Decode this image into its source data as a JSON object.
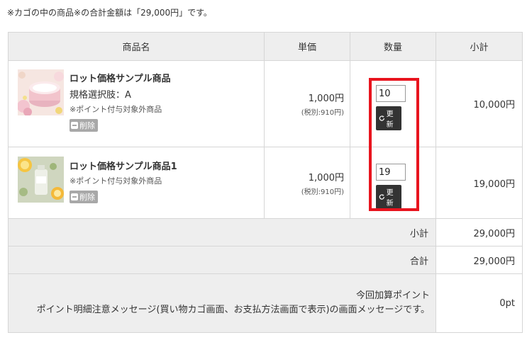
{
  "notice": "※カゴの中の商品※の合計金額は「29,000円」です。",
  "columns": {
    "product": "商品名",
    "unit_price": "単価",
    "quantity": "数量",
    "subtotal": "小計"
  },
  "items": [
    {
      "name": "ロット価格サンプル商品",
      "spec": "規格選択肢：A",
      "note": "※ポイント付与対象外商品",
      "delete_label": "削除",
      "price": "1,000円",
      "tax_note": "(税別:910円)",
      "quantity": "10",
      "update_label": "更新",
      "subtotal": "10,000円"
    },
    {
      "name": "ロット価格サンプル商品1",
      "spec": "",
      "note": "※ポイント付与対象外商品",
      "delete_label": "削除",
      "price": "1,000円",
      "tax_note": "(税別:910円)",
      "quantity": "19",
      "update_label": "更新",
      "subtotal": "19,000円"
    }
  ],
  "summary": {
    "subtotal_label": "小計",
    "subtotal_value": "29,000円",
    "total_label": "合計",
    "total_value": "29,000円",
    "points_label": "今回加算ポイント",
    "points_message": "ポイント明細注意メッセージ(買い物カゴ画面、お支払方法画面で表示)の画面メッセージです。",
    "points_value": "0pt"
  },
  "colors": {
    "highlight": "#e8141e",
    "update_button": "#333333",
    "delete_button": "#a8a8a8",
    "header_bg": "#eeeeee"
  },
  "icons": {
    "update": "refresh-icon",
    "delete": "minus-icon"
  }
}
